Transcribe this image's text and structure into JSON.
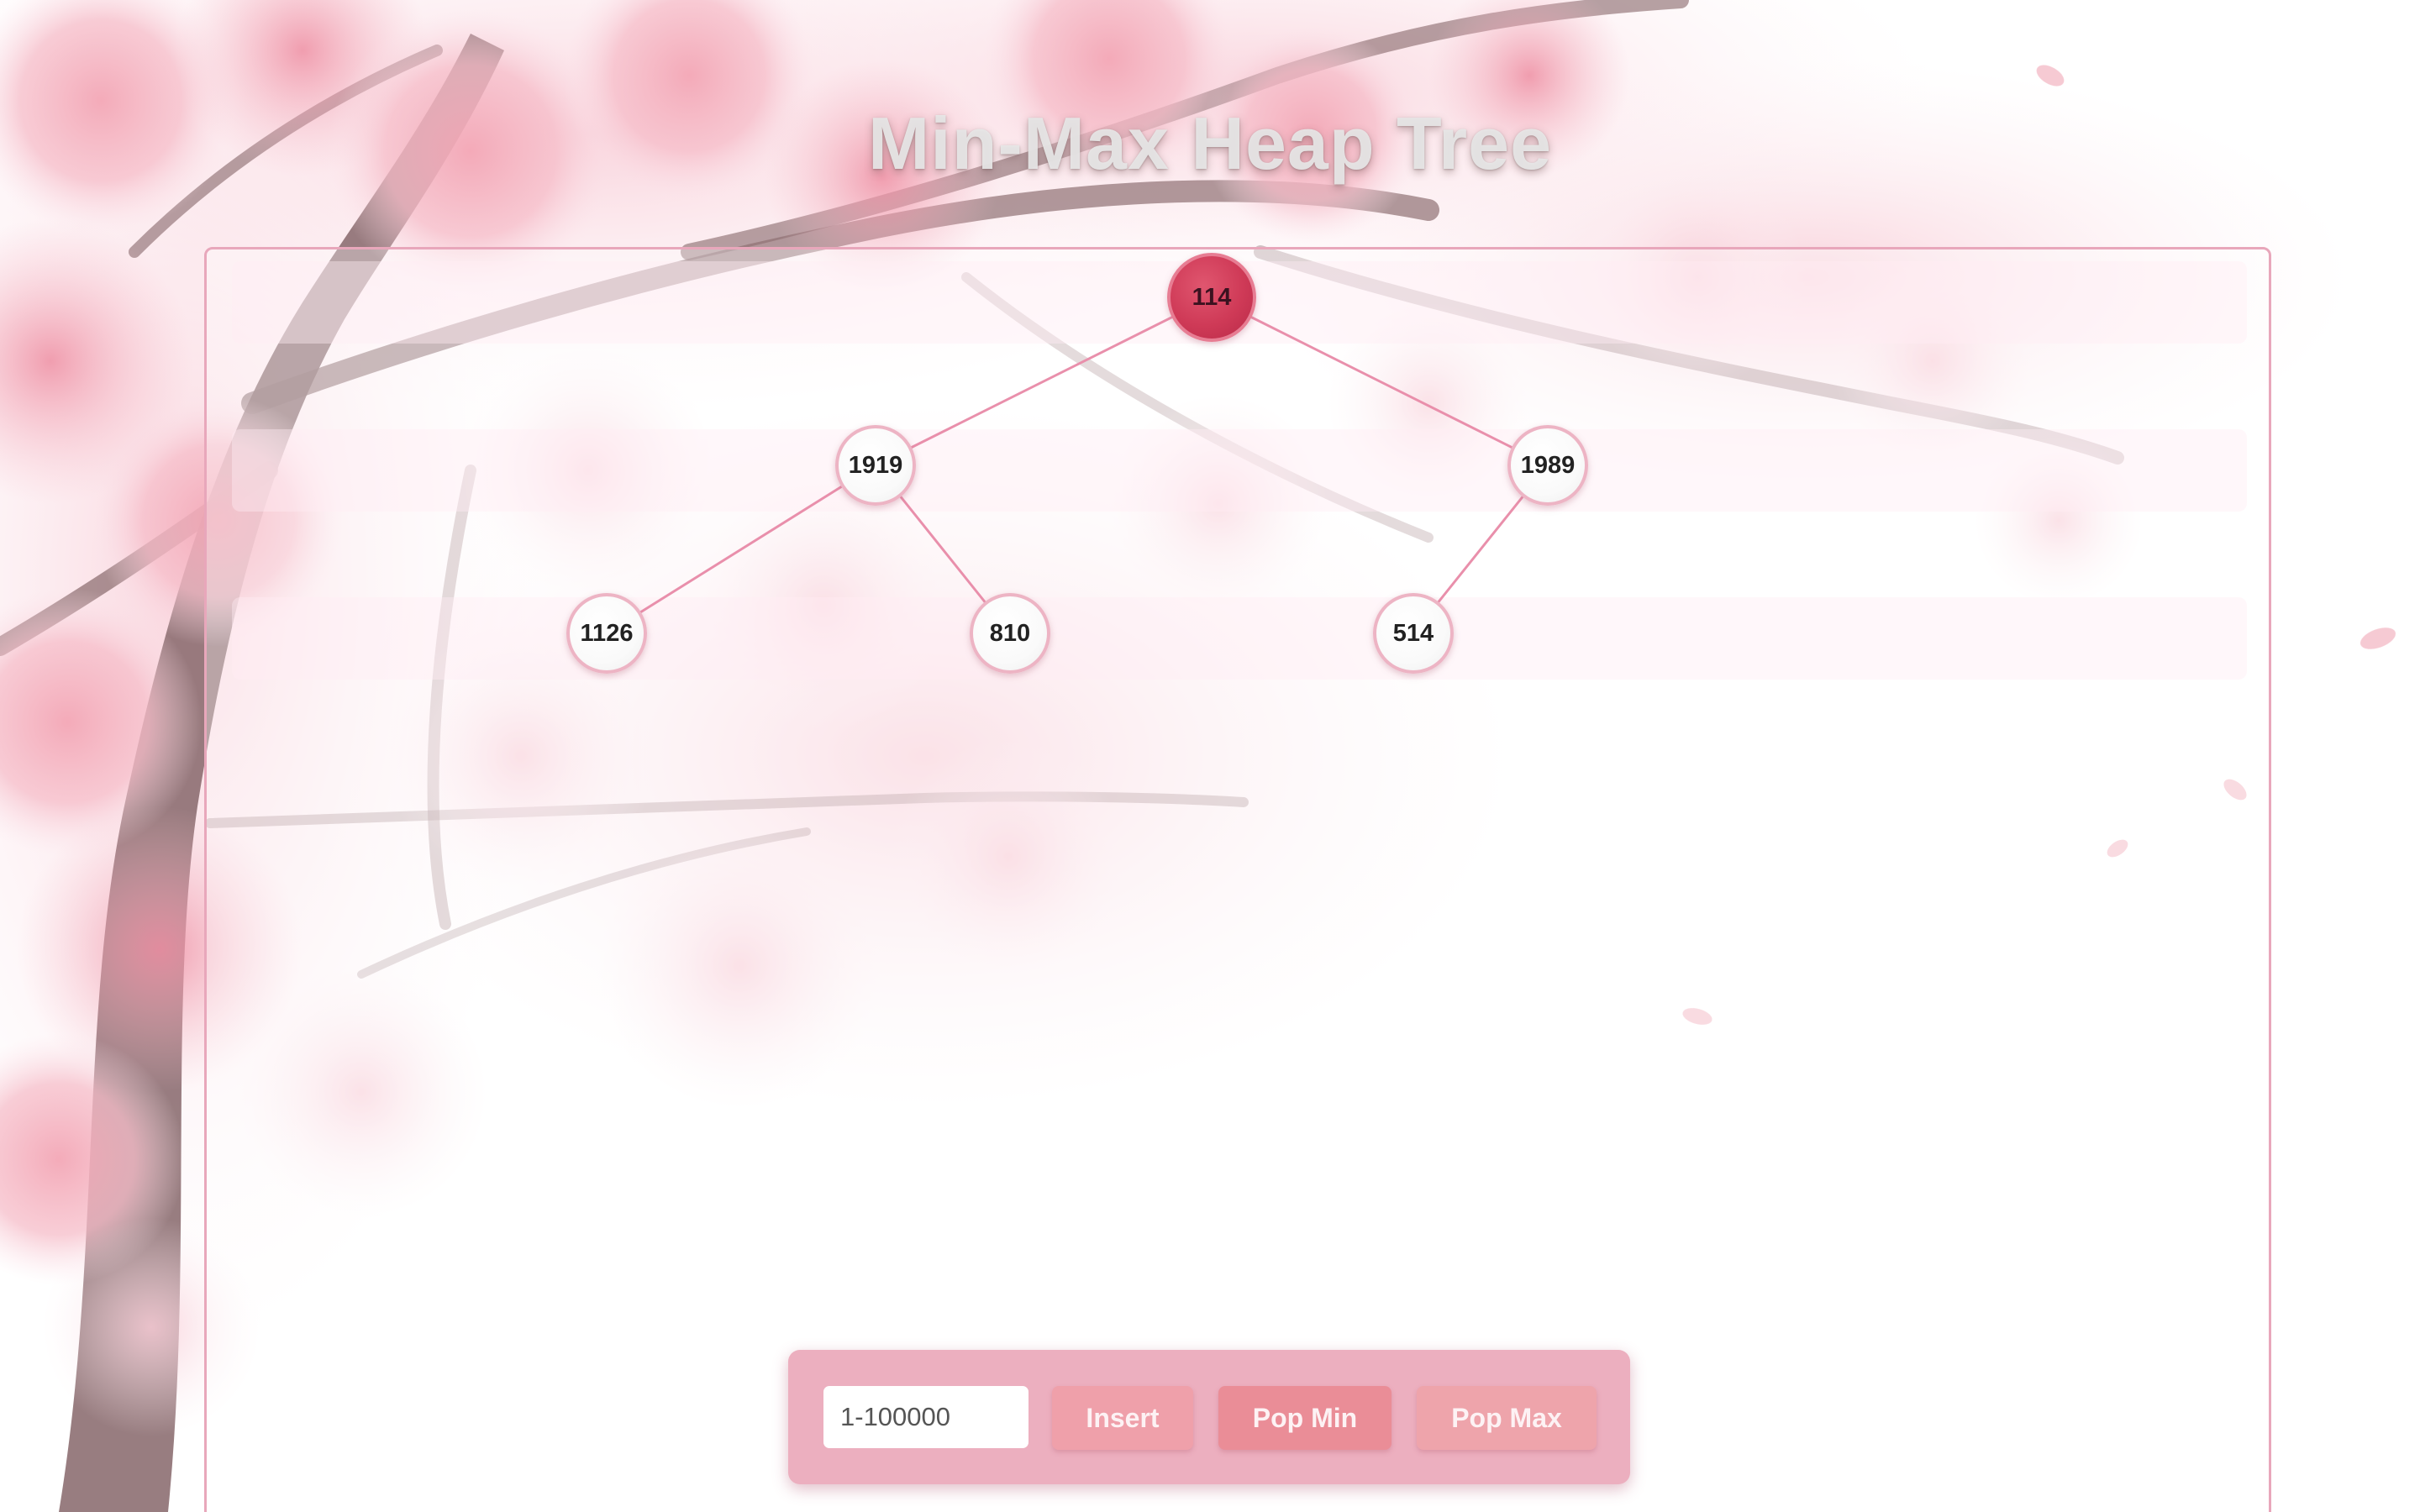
{
  "title": "Min-Max Heap Tree",
  "heap": {
    "values": [
      114,
      1919,
      1989,
      1126,
      810,
      514
    ],
    "levels": [
      {
        "index": 0,
        "nodes": [
          "114"
        ]
      },
      {
        "index": 1,
        "nodes": [
          "1919",
          "1989"
        ]
      },
      {
        "index": 2,
        "nodes": [
          "1126",
          "810",
          "514"
        ]
      }
    ],
    "root_color": "#cf3a57",
    "node_color": "#fafafa",
    "edge_color": "#e98fab"
  },
  "controls": {
    "input_placeholder": "1-100000",
    "insert_label": "Insert",
    "pop_min_label": "Pop Min",
    "pop_max_label": "Pop Max"
  },
  "theme": {
    "accent": "#ecafbf",
    "panel_border": "#e8a7bb",
    "background_motif": "cherry-blossom-tree"
  }
}
